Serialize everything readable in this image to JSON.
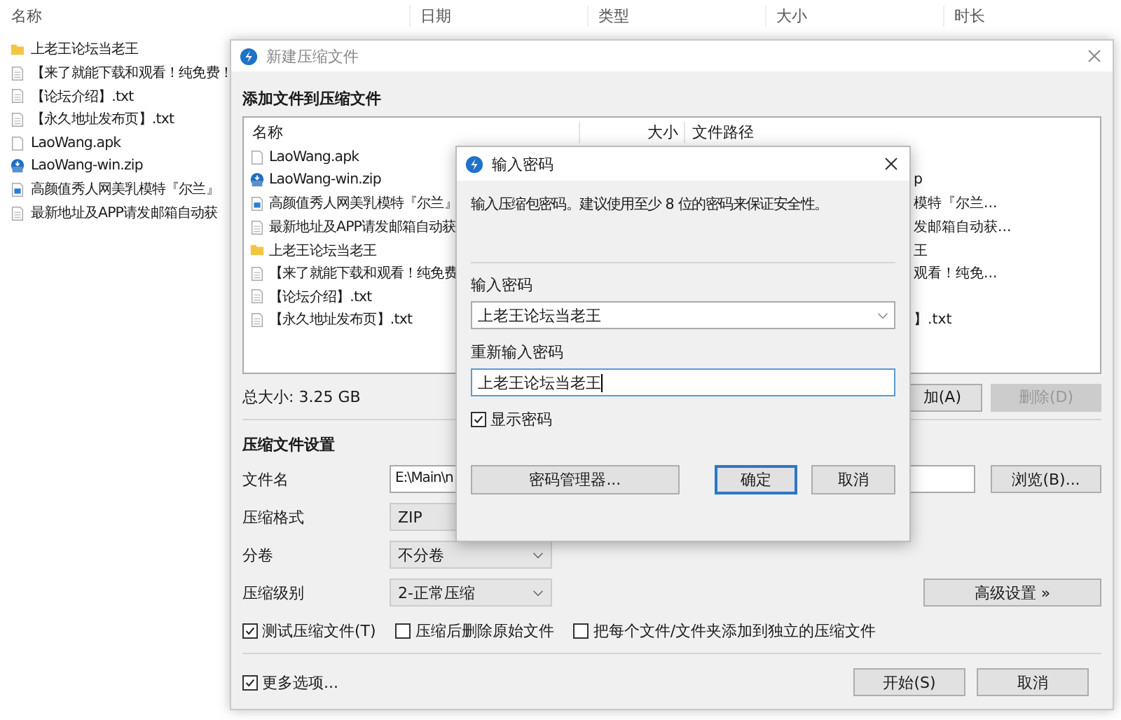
{
  "explorer": {
    "columns": [
      "名称",
      "日期",
      "类型",
      "大小",
      "时长"
    ],
    "items": [
      {
        "name": "上老王论坛当老王",
        "kind": "folder"
      },
      {
        "name": "【来了就能下载和观看！纯免费！",
        "kind": "text"
      },
      {
        "name": "【论坛介绍】.txt",
        "kind": "text"
      },
      {
        "name": "【永久地址发布页】.txt",
        "kind": "text"
      },
      {
        "name": "LaoWang.apk",
        "kind": "file"
      },
      {
        "name": "LaoWang-win.zip",
        "kind": "zip"
      },
      {
        "name": "高颜值秀人网美乳模特『尔兰』",
        "kind": "image"
      },
      {
        "name": "最新地址及APP请发邮箱自动获",
        "kind": "text"
      }
    ]
  },
  "compress_window": {
    "title": "新建压缩文件",
    "section": "添加文件到压缩文件",
    "list": {
      "columns": [
        "名称",
        "大小",
        "文件路径"
      ],
      "rows": [
        {
          "name": "LaoWang.apk",
          "kind": "file"
        },
        {
          "name": "LaoWang-win.zip",
          "kind": "zip",
          "path": "p"
        },
        {
          "name": "高颜值秀人网美乳模特『尔兰』",
          "kind": "image",
          "path": "模特『尔兰..."
        },
        {
          "name": "最新地址及APP请发邮箱自动获",
          "kind": "text",
          "path": "发邮箱自动获..."
        },
        {
          "name": "上老王论坛当老王",
          "kind": "folder",
          "path": "王"
        },
        {
          "name": "【来了就能下载和观看！纯免费",
          "kind": "text",
          "path": "观看！纯免..."
        },
        {
          "name": "【论坛介绍】.txt",
          "kind": "text"
        },
        {
          "name": "【永久地址发布页】.txt",
          "kind": "text",
          "path": "】.txt"
        }
      ]
    },
    "total": "总大小: 3.25 GB",
    "add_button": "加(A)",
    "delete_button": {
      "label": "删除(D)",
      "disabled": true
    },
    "settings_title": "压缩文件设置",
    "fields": [
      {
        "label": "文件名",
        "kind": "text",
        "value": "E:\\Main\\n"
      },
      {
        "label": "压缩格式",
        "kind": "select",
        "value": "ZIP"
      },
      {
        "label": "分卷",
        "kind": "select",
        "value": "不分卷"
      },
      {
        "label": "压缩级别",
        "kind": "select",
        "value": "2-正常压缩"
      }
    ],
    "browse_button": "浏览(B)...",
    "advanced_button": "高级设置 »",
    "options": [
      {
        "label": "测试压缩文件(T)",
        "checked": true
      },
      {
        "label": "压缩后删除原始文件",
        "checked": false
      },
      {
        "label": "把每个文件/文件夹添加到独立的压缩文件",
        "checked": false
      }
    ],
    "more_options": {
      "label": "更多选项...",
      "checked": true
    },
    "buttons": [
      "开始(S)",
      "取消"
    ]
  },
  "password_dialog": {
    "title": "输入密码",
    "message": "输入压缩包密码。建议使用至少 8 位的密码来保证安全性。",
    "password_label": "输入密码",
    "password": "上老王论坛当老王",
    "confirm_label": "重新输入密码",
    "confirm": "上老王论坛当老王",
    "show_password": {
      "label": "显示密码",
      "checked": true
    },
    "buttons": [
      {
        "label": "密码管理器...",
        "default": false
      },
      {
        "label": "确定",
        "default": true
      },
      {
        "label": "取消",
        "default": false
      }
    ]
  }
}
